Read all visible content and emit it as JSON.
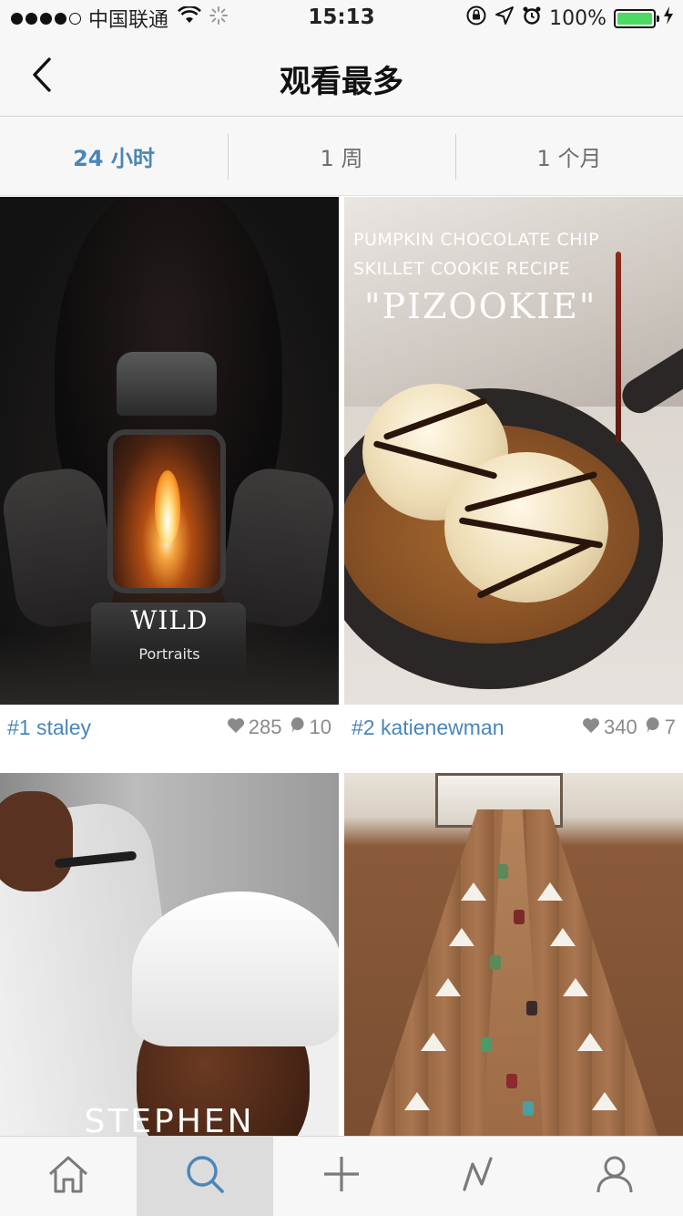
{
  "status_bar": {
    "carrier": "中国联通",
    "time": "15:13",
    "battery_percent": "100%",
    "battery_level": 1.0,
    "signal_bars_filled": 4,
    "signal_bars_total": 5
  },
  "nav": {
    "title": "观看最多",
    "back_icon": "chevron-left-icon"
  },
  "tabs": [
    {
      "label": "24 小时",
      "active": true
    },
    {
      "label": "1 周",
      "active": false
    },
    {
      "label": "1 个月",
      "active": false
    }
  ],
  "posts": [
    {
      "rank_user": "#1 staley",
      "likes": "285",
      "comments": "10",
      "overlay_title": "WILD",
      "overlay_subtitle": "Portraits"
    },
    {
      "rank_user": "#2 katienewman",
      "likes": "340",
      "comments": "7",
      "overlay_line1": "PUMPKIN CHOCOLATE CHIP",
      "overlay_line2": "SKILLET COOKIE RECIPE",
      "overlay_title": "\"PIZOOKIE\""
    },
    {
      "overlay_title": "STEPHEN"
    },
    {}
  ],
  "tab_bar": {
    "items": [
      {
        "icon": "home-icon",
        "active": false
      },
      {
        "icon": "search-icon",
        "active": true
      },
      {
        "icon": "add-icon",
        "active": false
      },
      {
        "icon": "activity-icon",
        "active": false
      },
      {
        "icon": "profile-icon",
        "active": false
      }
    ]
  },
  "colors": {
    "accent": "#4a86b8",
    "battery": "#4cd964",
    "meta_gray": "#8a8a8a"
  }
}
